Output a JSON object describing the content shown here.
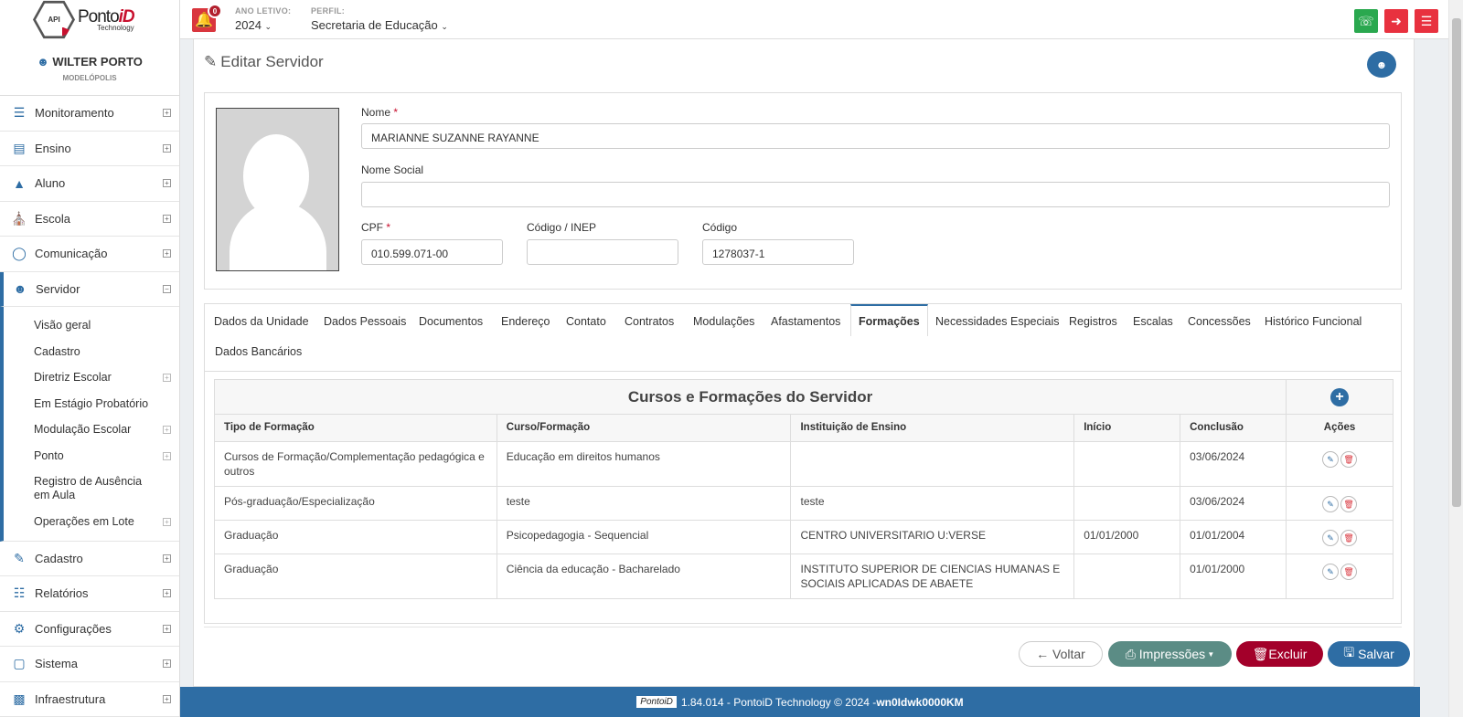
{
  "brand": {
    "name_a": "Ponto",
    "name_b": "iD",
    "sub": "Technology",
    "badge": "API"
  },
  "topbar": {
    "notif_count": "0",
    "ano_label": "ANO LETIVO:",
    "ano_value": "2024",
    "perfil_label": "PERFIL:",
    "perfil_value": "Secretaria de Educação",
    "colors": {
      "whatsapp": "#2aa84f",
      "logout": "#e8313f",
      "menu": "#e8313f"
    }
  },
  "user": {
    "name": "WILTER PORTO",
    "city": "MODELÓPOLIS"
  },
  "sidebar": {
    "items": [
      {
        "label": "Monitoramento",
        "icon": "sliders-icon"
      },
      {
        "label": "Ensino",
        "icon": "book-icon"
      },
      {
        "label": "Aluno",
        "icon": "graduation-cap-icon"
      },
      {
        "label": "Escola",
        "icon": "bank-icon"
      },
      {
        "label": "Comunicação",
        "icon": "chat-icon"
      },
      {
        "label": "Servidor",
        "icon": "user-icon"
      }
    ],
    "servidor_sub": [
      "Visão geral",
      "Cadastro",
      "Diretriz Escolar",
      "Em Estágio Probatório",
      "Modulação Escolar",
      "Ponto",
      "Registro de Ausência em Aula",
      "Operações em Lote"
    ],
    "items_after": [
      {
        "label": "Cadastro",
        "icon": "edit-icon"
      },
      {
        "label": "Relatórios",
        "icon": "file-icon"
      },
      {
        "label": "Configurações",
        "icon": "gear-icon"
      },
      {
        "label": "Sistema",
        "icon": "monitor-icon"
      },
      {
        "label": "Infraestrutura",
        "icon": "building-icon"
      }
    ]
  },
  "page": {
    "title": "Editar Servidor"
  },
  "form": {
    "nome_label": "Nome",
    "nome_value": "MARIANNE SUZANNE RAYANNE",
    "nome_social_label": "Nome Social",
    "nome_social_value": "",
    "cpf_label": "CPF",
    "cpf_value": "010.599.071-00",
    "inep_label": "Código / INEP",
    "inep_value": "",
    "codigo_label": "Código",
    "codigo_value": "1278037-1",
    "required_mark": "*"
  },
  "tabs": [
    "Dados da Unidade",
    "Dados Pessoais",
    "Documentos",
    "Endereço",
    "Contato",
    "Contratos",
    "Modulações",
    "Afastamentos",
    "Formações",
    "Necessidades Especiais",
    "Registros",
    "Escalas",
    "Concessões",
    "Histórico Funcional",
    "Dados Bancários"
  ],
  "active_tab": "Formações",
  "table": {
    "caption": "Cursos e Formações do Servidor",
    "headers": [
      "Tipo de Formação",
      "Curso/Formação",
      "Instituição de Ensino",
      "Início",
      "Conclusão",
      "Ações"
    ],
    "rows": [
      [
        "Cursos de Formação/Complementação pedagógica e outros",
        "Educação em direitos humanos",
        "",
        "",
        "03/06/2024"
      ],
      [
        "Pós-graduação/Especialização",
        "teste",
        "teste",
        "",
        "03/06/2024"
      ],
      [
        "Graduação",
        "Psicopedagogia - Sequencial",
        "CENTRO UNIVERSITARIO U:VERSE",
        "01/01/2000",
        "01/01/2004"
      ],
      [
        "Graduação",
        "Ciência da educação - Bacharelado",
        "INSTITUTO SUPERIOR DE CIENCIAS HUMANAS E SOCIAIS APLICADAS DE ABAETE",
        "",
        "01/01/2000"
      ]
    ]
  },
  "actions": {
    "voltar": "Voltar",
    "impressoes": "Impressões",
    "excluir": "Excluir",
    "salvar": "Salvar",
    "colors": {
      "impressoes": "#5b8c85",
      "excluir": "#a3002a",
      "salvar": "#2e6da4"
    }
  },
  "footer": {
    "logo": "PontoiD",
    "version": "1.84.014 - PontoiD Technology © 2024 - ",
    "code": "wn0Idwk0000KM"
  }
}
